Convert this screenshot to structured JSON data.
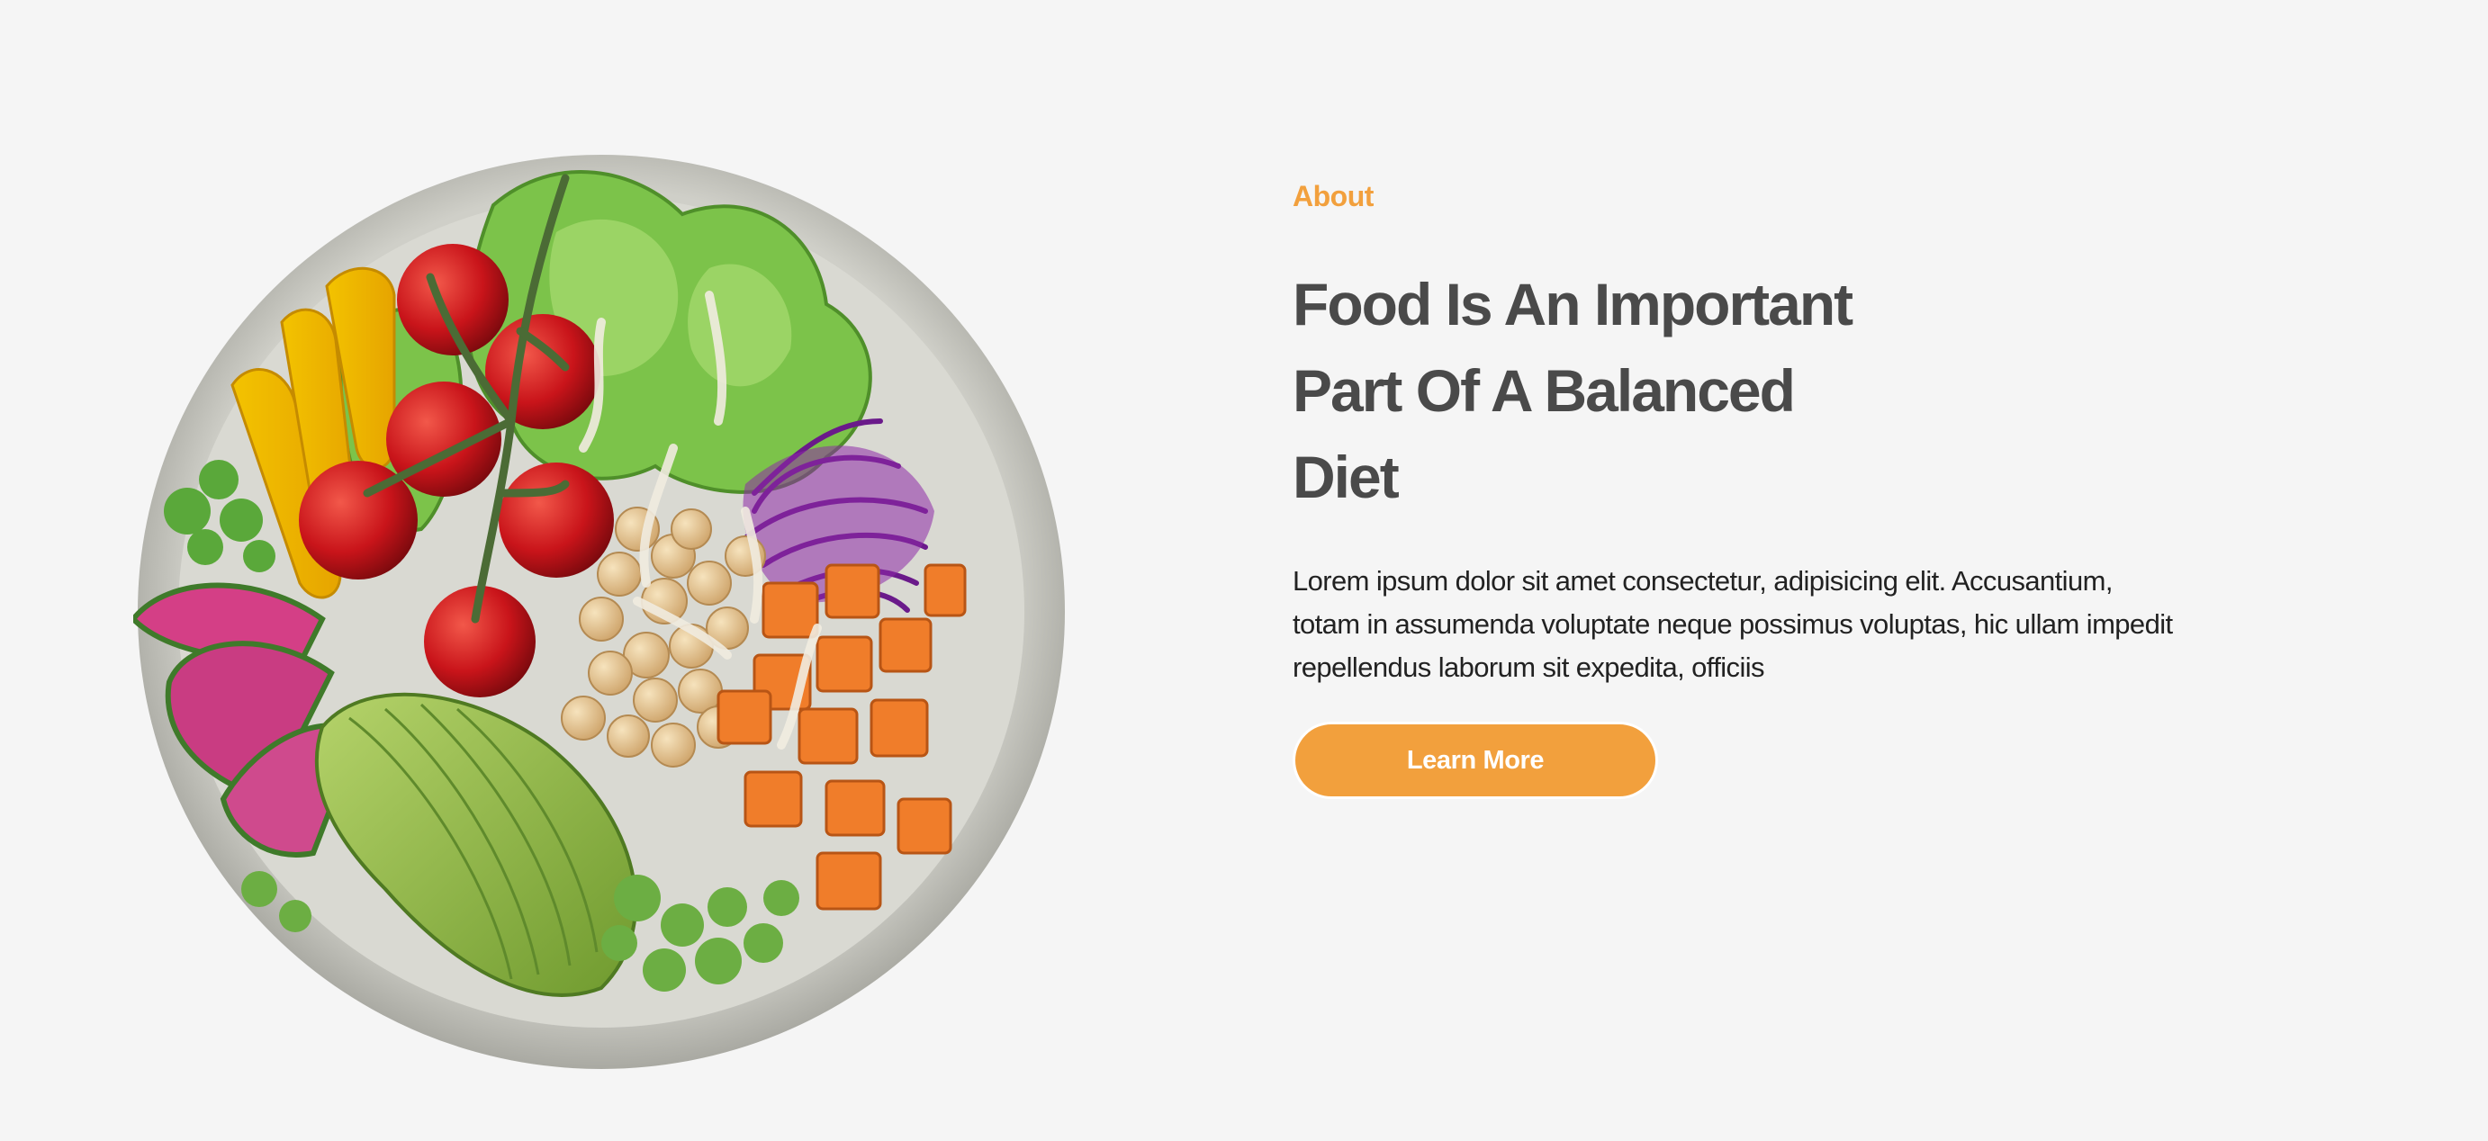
{
  "theme": {
    "background": "#f5f5f5",
    "accent": "#f2a03d",
    "heading_color": "#4a4a4a",
    "body_color": "#222222",
    "button_text_color": "#ffffff"
  },
  "about": {
    "eyebrow": "About",
    "title_lines": [
      "Food Is An Important",
      "Part Of A Balanced",
      "Diet"
    ],
    "description_lines": [
      "Lorem ipsum dolor sit amet consectetur, adipisicing elit. Accusantium,",
      "totam in assumenda voluptate neque possimus voluptas, hic ullam impedit",
      "repellendus laborum sit expedita, officiis"
    ],
    "cta_label": "Learn More"
  },
  "image": {
    "subject": "salad-bowl"
  }
}
